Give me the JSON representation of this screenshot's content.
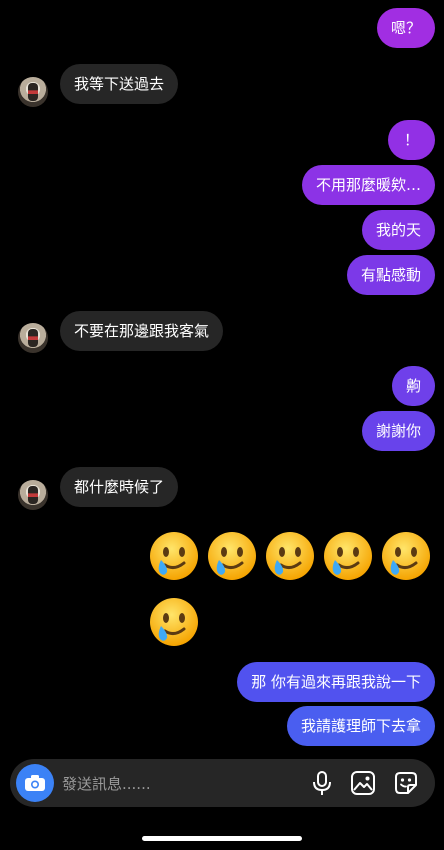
{
  "messages": {
    "m0": "嗯？",
    "m1": "我等下送過去",
    "m2": "！",
    "m3": "不用那麼暖欸…",
    "m4": "我的天",
    "m5": "有點感動",
    "m6": "不要在那邊跟我客氣",
    "m7": "齁",
    "m8": "謝謝你",
    "m9": "都什麼時候了",
    "m10": "那 你有過來再跟我說一下",
    "m11": "我請護理師下去拿"
  },
  "emoji_name": "face-holding-back-tears-smile-emoji",
  "composer": {
    "placeholder": "發送訊息......"
  },
  "colors": {
    "bubble_in": "#262626",
    "bubble_out_top": "#9b2fe6",
    "bubble_out_mid": "#7a3ee8",
    "bubble_out_bottom": "#4a5ef0",
    "accent_blue": "#3b82f6"
  }
}
